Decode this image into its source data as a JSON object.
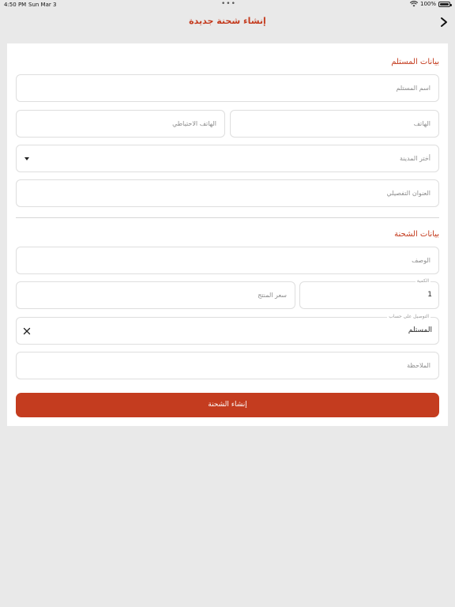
{
  "status": {
    "time": "4:50 PM",
    "date": "Sun Mar 3",
    "battery": "100%",
    "battery_level": 1.0
  },
  "header": {
    "title": "إنشاء شحنة جديدة",
    "back_icon": "chevron-right-icon"
  },
  "receiver": {
    "section_title": "بيانات المستلم",
    "name_placeholder": "اسم المستلم",
    "phone_placeholder": "الهاتف",
    "alt_phone_placeholder": "الهاتف الاحتياطي",
    "city_placeholder": "أختر المدينة",
    "address_placeholder": "العنوان التفصيلي"
  },
  "shipment": {
    "section_title": "بيانات الشحنة",
    "description_placeholder": "الوصف",
    "quantity_label": "الكمية",
    "quantity_value": "1",
    "price_placeholder": "سعر المنتج",
    "delivery_label": "التوصيل على حساب",
    "delivery_value": "المستلم",
    "note_placeholder": "الملاحظة"
  },
  "submit_label": "إنشاء الشحنة",
  "colors": {
    "accent": "#c43c1f",
    "background": "#e9e9e9",
    "card": "#ffffff",
    "border": "#dedede"
  }
}
